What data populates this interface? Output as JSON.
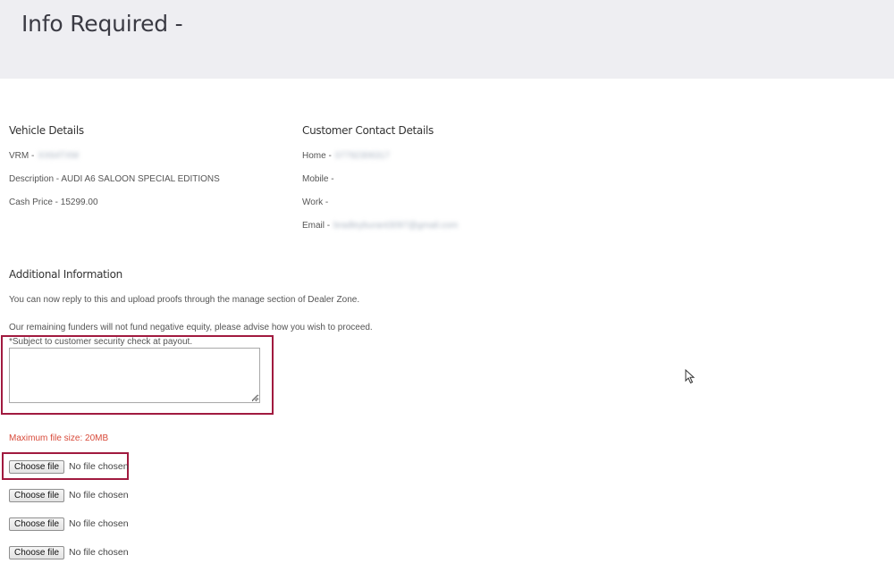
{
  "header": {
    "title": "Info Required -"
  },
  "vehicle": {
    "heading": "Vehicle Details",
    "vrm_label": "VRM -",
    "vrm_value": "XX64TXM",
    "description": "Description - AUDI A6 SALOON SPECIAL EDITIONS",
    "cash_price": "Cash Price - 15299.00"
  },
  "contact": {
    "heading": "Customer Contact Details",
    "home_label": "Home -",
    "home_value": "07792306317",
    "mobile_label": "Mobile -",
    "work_label": "Work -",
    "email_label": "Email -",
    "email_value": "bradleyburant3097@gmail.com"
  },
  "additional": {
    "heading": "Additional Information",
    "reply_text": "You can now reply to this and upload proofs through the manage section of Dealer Zone.",
    "funders_text": "Our remaining funders will not fund negative equity, please advise how you wish to proceed.",
    "security_note": "*Subject to customer security check at payout.",
    "reply_value": ""
  },
  "upload": {
    "max_size": "Maximum file size: 20MB",
    "files": [
      {
        "button": "Choose file",
        "status": "No file chosen"
      },
      {
        "button": "Choose file",
        "status": "No file chosen"
      },
      {
        "button": "Choose file",
        "status": "No file chosen"
      },
      {
        "button": "Choose file",
        "status": "No file chosen"
      }
    ]
  },
  "colors": {
    "header_bg": "#eeeef2",
    "highlight": "#a11a3f",
    "warning": "#d84a3a"
  },
  "icons": [
    "mouse-pointer-icon",
    "resize-grip-icon"
  ]
}
